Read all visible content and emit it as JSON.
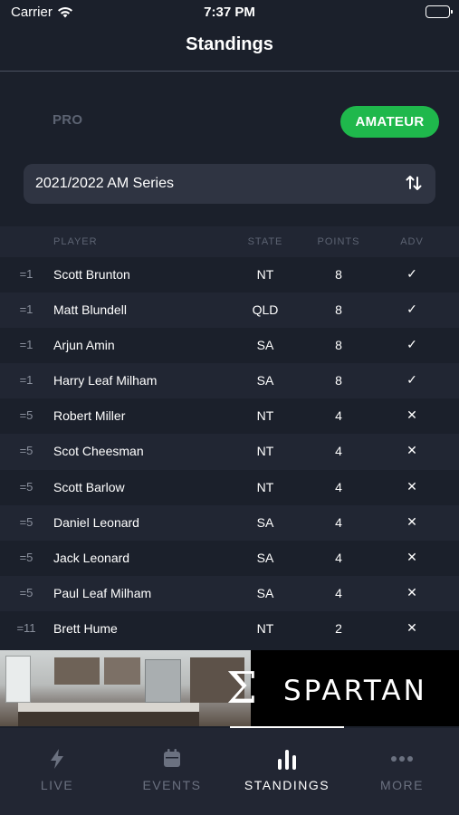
{
  "status_bar": {
    "carrier": "Carrier",
    "time": "7:37 PM"
  },
  "header": {
    "title": "Standings"
  },
  "segments": {
    "pro": "PRO",
    "amateur": "AMATEUR",
    "selected": "AMATEUR"
  },
  "series_select": {
    "value": "2021/2022 AM Series"
  },
  "table": {
    "headers": {
      "player": "PLAYER",
      "state": "STATE",
      "points": "POINTS",
      "adv": "ADV"
    },
    "rows": [
      {
        "rank": "=1",
        "player": "Scott Brunton",
        "state": "NT",
        "points": "8",
        "adv": "✓"
      },
      {
        "rank": "=1",
        "player": "Matt Blundell",
        "state": "QLD",
        "points": "8",
        "adv": "✓"
      },
      {
        "rank": "=1",
        "player": "Arjun Amin",
        "state": "SA",
        "points": "8",
        "adv": "✓"
      },
      {
        "rank": "=1",
        "player": "Harry Leaf Milham",
        "state": "SA",
        "points": "8",
        "adv": "✓"
      },
      {
        "rank": "=5",
        "player": "Robert Miller",
        "state": "NT",
        "points": "4",
        "adv": "✕"
      },
      {
        "rank": "=5",
        "player": "Scot Cheesman",
        "state": "NT",
        "points": "4",
        "adv": "✕"
      },
      {
        "rank": "=5",
        "player": "Scott Barlow",
        "state": "NT",
        "points": "4",
        "adv": "✕"
      },
      {
        "rank": "=5",
        "player": "Daniel Leonard",
        "state": "SA",
        "points": "4",
        "adv": "✕"
      },
      {
        "rank": "=5",
        "player": "Jack Leonard",
        "state": "SA",
        "points": "4",
        "adv": "✕"
      },
      {
        "rank": "=5",
        "player": "Paul Leaf Milham",
        "state": "SA",
        "points": "4",
        "adv": "✕"
      },
      {
        "rank": "=11",
        "player": "Brett Hume",
        "state": "NT",
        "points": "2",
        "adv": "✕"
      }
    ]
  },
  "banner": {
    "brand": "SPARTAN",
    "symbol": "Σ"
  },
  "tabbar": {
    "tabs": [
      {
        "label": "LIVE",
        "icon": "lightning-icon"
      },
      {
        "label": "EVENTS",
        "icon": "calendar-icon"
      },
      {
        "label": "STANDINGS",
        "icon": "bar-chart-icon"
      },
      {
        "label": "MORE",
        "icon": "more-dots-icon"
      }
    ],
    "active": "STANDINGS"
  },
  "colors": {
    "background": "#1b202b",
    "row_alt": "#212633",
    "accent_green": "#1fb84c",
    "muted_text": "#5d6473"
  }
}
